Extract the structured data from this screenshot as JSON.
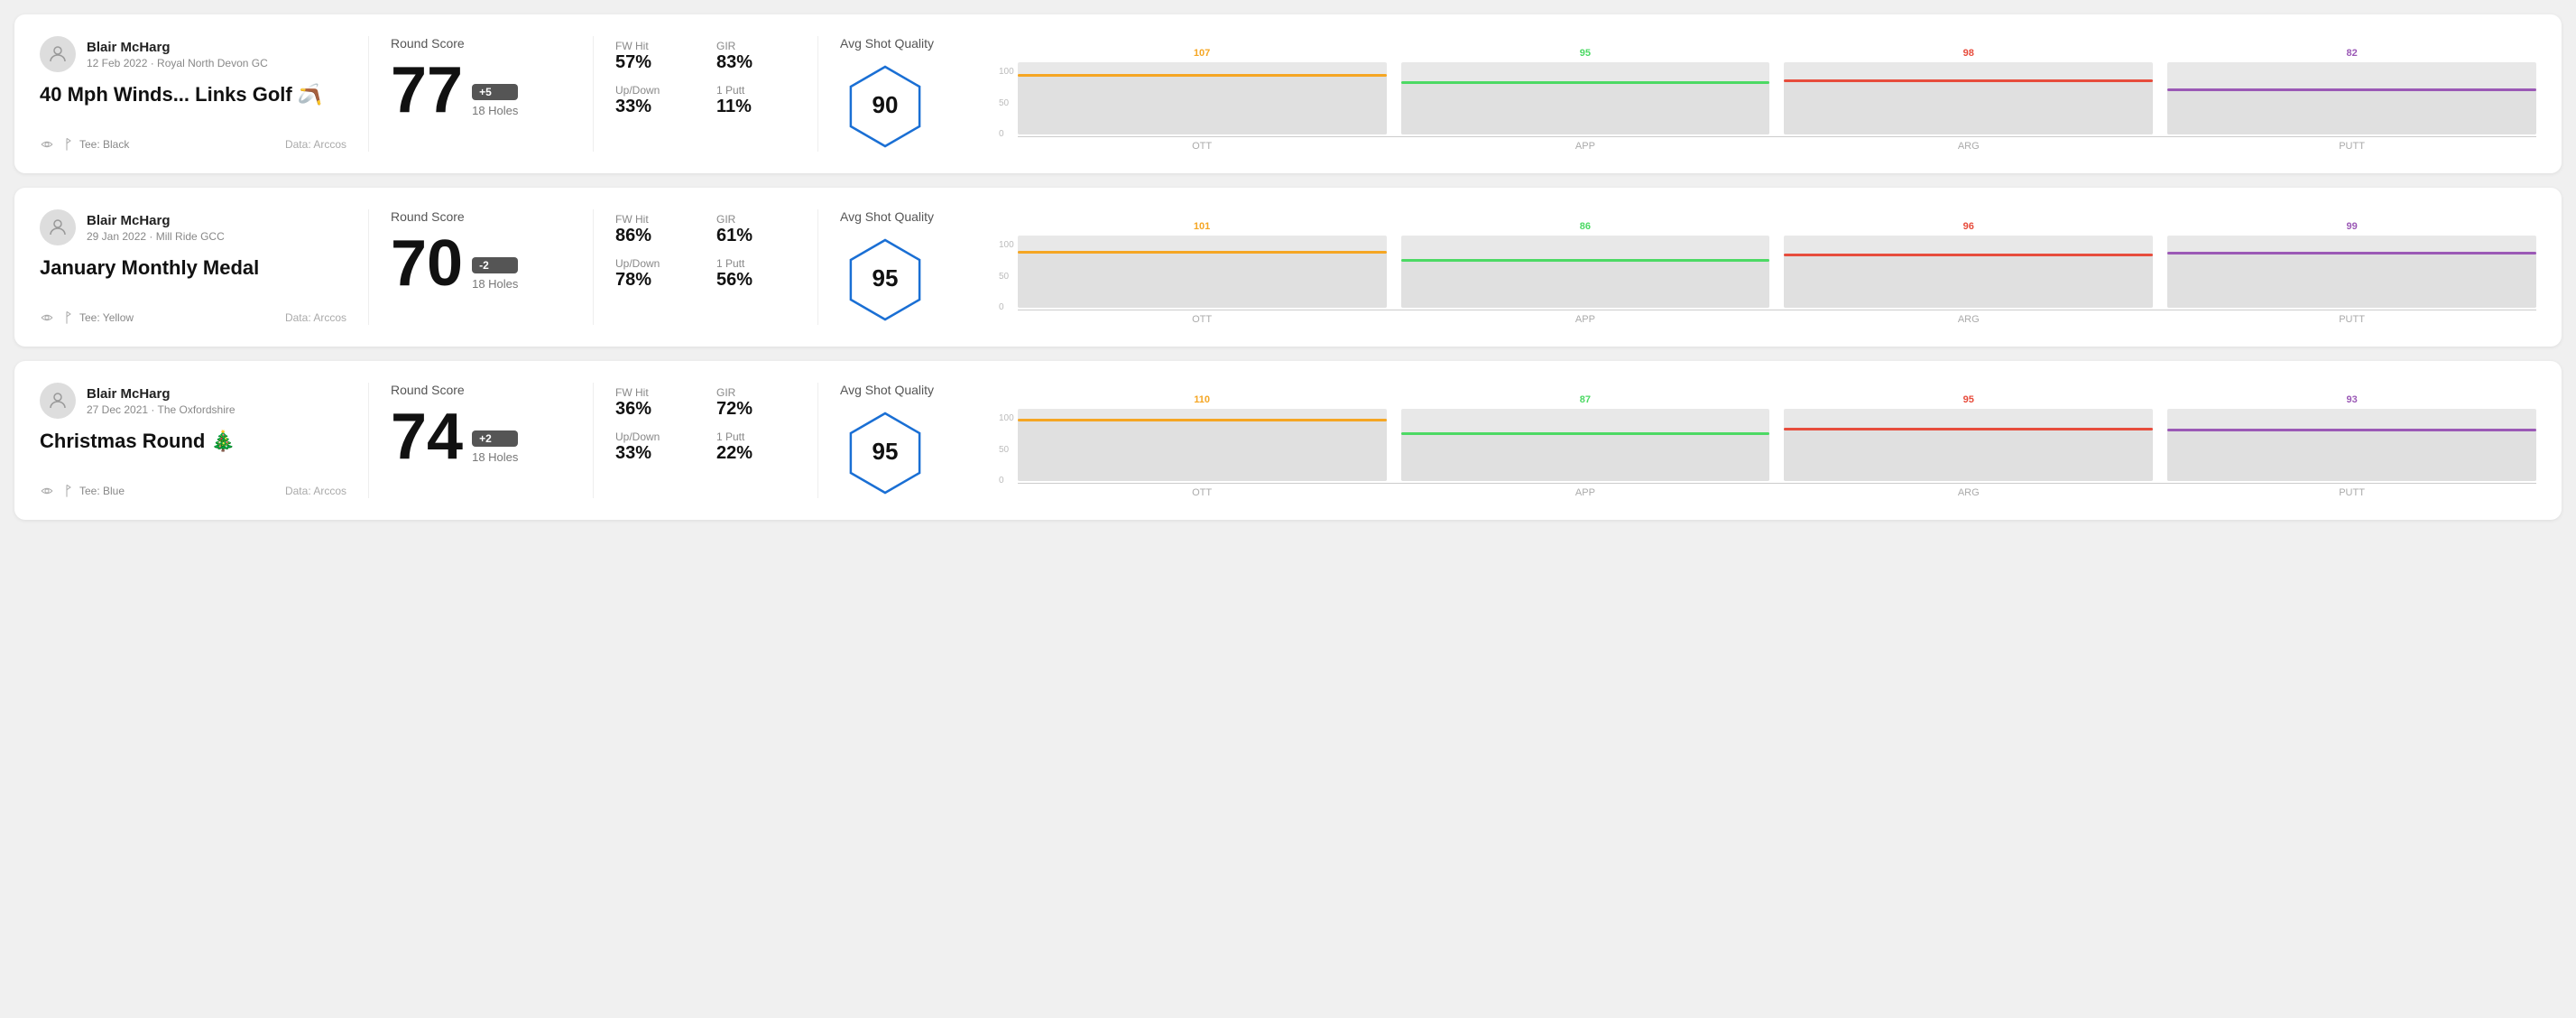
{
  "rounds": [
    {
      "id": "round1",
      "user": {
        "name": "Blair McHarg",
        "date_course": "12 Feb 2022 · Royal North Devon GC"
      },
      "title": "40 Mph Winds... Links Golf 🪃",
      "tee": "Black",
      "data_source": "Data: Arccos",
      "score": {
        "label": "Round Score",
        "number": "77",
        "badge": "+5",
        "holes": "18 Holes"
      },
      "stats": {
        "fw_hit_label": "FW Hit",
        "fw_hit_value": "57%",
        "gir_label": "GIR",
        "gir_value": "83%",
        "updown_label": "Up/Down",
        "updown_value": "33%",
        "oneputt_label": "1 Putt",
        "oneputt_value": "11%"
      },
      "quality": {
        "label": "Avg Shot Quality",
        "score": "90"
      },
      "chart": {
        "categories": [
          "OTT",
          "APP",
          "ARG",
          "PUTT"
        ],
        "values": [
          107,
          95,
          98,
          82
        ],
        "colors": [
          "#f5a623",
          "#4cd964",
          "#e74c3c",
          "#9b59b6"
        ],
        "max": 120
      }
    },
    {
      "id": "round2",
      "user": {
        "name": "Blair McHarg",
        "date_course": "29 Jan 2022 · Mill Ride GCC"
      },
      "title": "January Monthly Medal",
      "tee": "Yellow",
      "data_source": "Data: Arccos",
      "score": {
        "label": "Round Score",
        "number": "70",
        "badge": "-2",
        "holes": "18 Holes"
      },
      "stats": {
        "fw_hit_label": "FW Hit",
        "fw_hit_value": "86%",
        "gir_label": "GIR",
        "gir_value": "61%",
        "updown_label": "Up/Down",
        "updown_value": "78%",
        "oneputt_label": "1 Putt",
        "oneputt_value": "56%"
      },
      "quality": {
        "label": "Avg Shot Quality",
        "score": "95"
      },
      "chart": {
        "categories": [
          "OTT",
          "APP",
          "ARG",
          "PUTT"
        ],
        "values": [
          101,
          86,
          96,
          99
        ],
        "colors": [
          "#f5a623",
          "#4cd964",
          "#e74c3c",
          "#9b59b6"
        ],
        "max": 120
      }
    },
    {
      "id": "round3",
      "user": {
        "name": "Blair McHarg",
        "date_course": "27 Dec 2021 · The Oxfordshire"
      },
      "title": "Christmas Round 🎄",
      "tee": "Blue",
      "data_source": "Data: Arccos",
      "score": {
        "label": "Round Score",
        "number": "74",
        "badge": "+2",
        "holes": "18 Holes"
      },
      "stats": {
        "fw_hit_label": "FW Hit",
        "fw_hit_value": "36%",
        "gir_label": "GIR",
        "gir_value": "72%",
        "updown_label": "Up/Down",
        "updown_value": "33%",
        "oneputt_label": "1 Putt",
        "oneputt_value": "22%"
      },
      "quality": {
        "label": "Avg Shot Quality",
        "score": "95"
      },
      "chart": {
        "categories": [
          "OTT",
          "APP",
          "ARG",
          "PUTT"
        ],
        "values": [
          110,
          87,
          95,
          93
        ],
        "colors": [
          "#f5a623",
          "#4cd964",
          "#e74c3c",
          "#9b59b6"
        ],
        "max": 120
      }
    }
  ]
}
